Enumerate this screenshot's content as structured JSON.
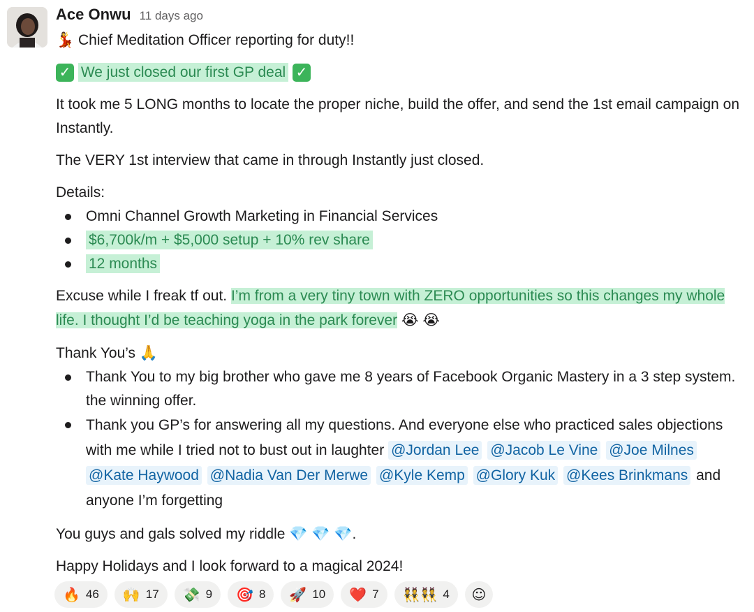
{
  "message": {
    "author": "Ace Onwu",
    "timestamp": "11 days ago",
    "title_line": "Chief Meditation Officer reporting for duty!!",
    "highlight_headline": "We just closed our first GP deal",
    "para1": "It took me 5 LONG months to locate the proper niche, build the offer, and send the 1st email campaign on Instantly.",
    "para2": "The VERY 1st interview that came in through Instantly just closed.",
    "details_label": "Details:",
    "details": [
      "Omni Channel Growth Marketing in Financial Services",
      "$6,700k/m + $5,000 setup + 10% rev share",
      "12 months"
    ],
    "excuse_start": "Excuse while I freak tf out.",
    "excuse_highlight": "I’m from a very tiny town with ZERO opportunities so this changes my whole life. I thought I’d be teaching yoga in the park forever",
    "thank_label": "Thank You’s",
    "thanks": [
      "Thank You to my big brother who gave me 8 years of Facebook Organic Mastery in a 3 step system. the winning offer.",
      "Thank you GP’s for answering all my questions. And everyone else who practiced sales objections with me while I tried not to bust out in laughter"
    ],
    "mentions": [
      "@Jordan Lee",
      "@Jacob Le Vine",
      "@Joe Milnes",
      "@Kate Haywood",
      "@Nadia Van Der Merwe",
      "@Kyle Kemp",
      "@Glory Kuk",
      "@Kees Brinkmans"
    ],
    "mentions_tail": "and anyone I’m forgetting",
    "riddle": "You guys and gals solved my riddle",
    "riddle_end": ".",
    "closing": "Happy Holidays and I look forward to a magical 2024!"
  },
  "reactions": [
    {
      "icon": "fire-icon",
      "glyph": "🔥",
      "count": "46"
    },
    {
      "icon": "raised-hands-icon",
      "glyph": "🙌",
      "count": "17"
    },
    {
      "icon": "money-icon",
      "glyph": "💸",
      "count": "9"
    },
    {
      "icon": "target-icon",
      "glyph": "🎯",
      "count": "8"
    },
    {
      "icon": "rocket-icon",
      "glyph": "🚀",
      "count": "10"
    },
    {
      "icon": "heart-icon",
      "glyph": "❤️",
      "count": "7"
    },
    {
      "icon": "dancers-icon",
      "glyph": "👯👯",
      "count": "4"
    }
  ],
  "emoji": {
    "dancer": "💃",
    "check": "✓",
    "crying": "😭",
    "pray": "🙏",
    "gem": "💎",
    "add_reaction": "☺"
  },
  "colors": {
    "highlight_bg": "#c6f0d6",
    "highlight_text": "#2b8a52",
    "mention_bg": "#e8f3fb",
    "mention_text": "#1264a3"
  }
}
